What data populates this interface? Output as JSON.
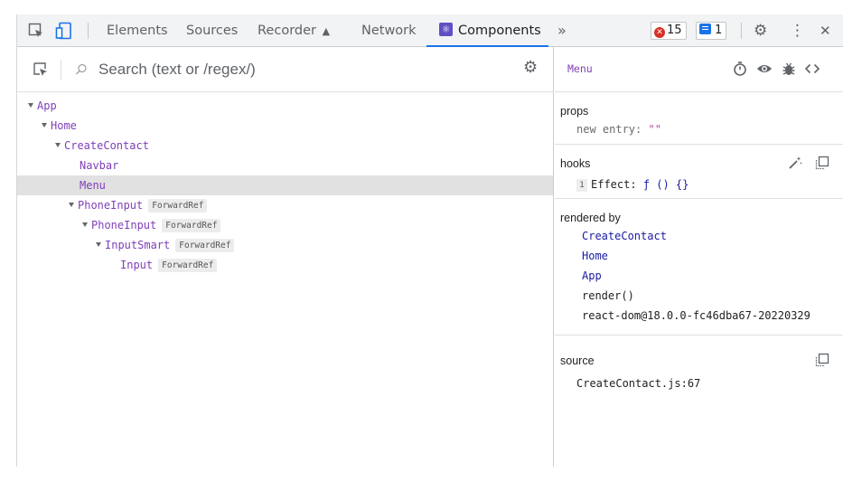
{
  "toolbar": {
    "tabs": [
      "Elements",
      "Sources",
      "Recorder",
      "Network",
      "Components"
    ],
    "recorder_suffix": "▲",
    "more": "»",
    "error_count": "15",
    "message_count": "1",
    "close": "✕",
    "kebab": "⋮",
    "gear": "⚙"
  },
  "search": {
    "placeholder": "Search (text or /regex/)",
    "icon": "⚲",
    "settings": "⚙"
  },
  "tree": [
    {
      "name": "App",
      "hoc": ""
    },
    {
      "name": "Home",
      "hoc": ""
    },
    {
      "name": "CreateContact",
      "hoc": ""
    },
    {
      "name": "Navbar",
      "hoc": ""
    },
    {
      "name": "Menu",
      "hoc": ""
    },
    {
      "name": "PhoneInput",
      "hoc": "ForwardRef"
    },
    {
      "name": "PhoneInput",
      "hoc": "ForwardRef"
    },
    {
      "name": "InputSmart",
      "hoc": "ForwardRef"
    },
    {
      "name": "Input",
      "hoc": "ForwardRef"
    }
  ],
  "selected_component": "Menu",
  "props": {
    "title": "props",
    "key": "new entry:",
    "value": "\"\""
  },
  "hooks": {
    "title": "hooks",
    "index": "1",
    "name": "Effect:",
    "value": "ƒ () {}"
  },
  "rendered_by": {
    "title": "rendered by",
    "items": [
      "CreateContact",
      "Home",
      "App"
    ],
    "render": "render()",
    "react_dom": "react-dom@18.0.0-fc46dba67-20220329"
  },
  "source": {
    "title": "source",
    "file": "CreateContact.js:67"
  },
  "colors": {
    "component": "#7e3fb8",
    "link": "#1a1aa6",
    "accent": "#1a73e8",
    "error": "#d93025"
  }
}
